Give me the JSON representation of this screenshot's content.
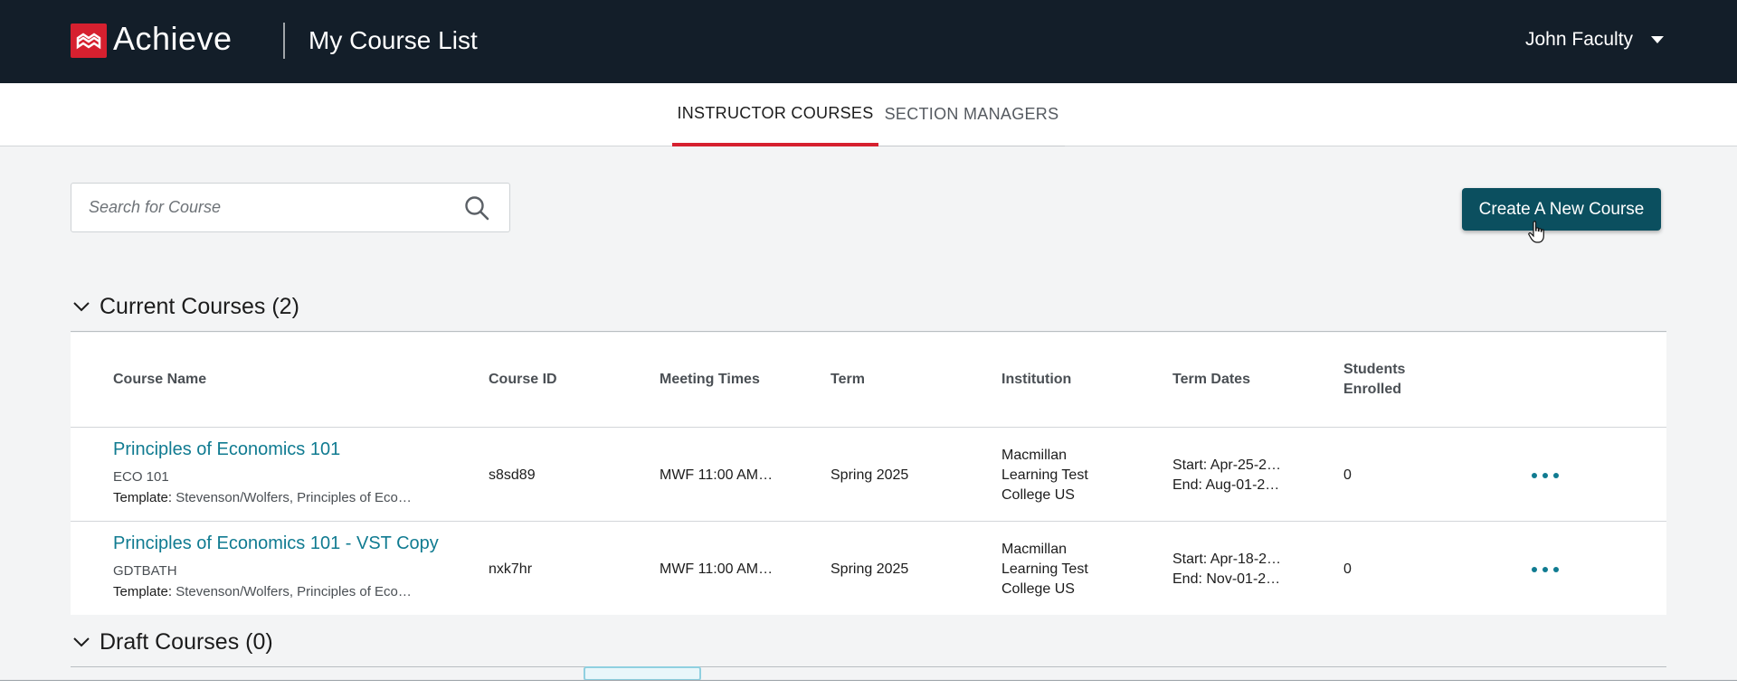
{
  "header": {
    "logo_text": "Achieve",
    "title": "My Course List",
    "user_name": "John Faculty"
  },
  "tabs": [
    {
      "label": "INSTRUCTOR COURSES",
      "active": true
    },
    {
      "label": "SECTION MANAGERS",
      "active": false
    }
  ],
  "search": {
    "placeholder": "Search for Course",
    "value": ""
  },
  "create_button": {
    "label": "Create A New Course"
  },
  "current_courses": {
    "title": "Current Courses (2)",
    "columns": [
      "Course Name",
      "Course ID",
      "Meeting Times",
      "Term",
      "Institution",
      "Term Dates",
      "Students Enrolled"
    ],
    "column_lines": {
      "students_line1": "Students",
      "students_line2": "Enrolled"
    },
    "rows": [
      {
        "name": "Principles of Economics 101",
        "code": "ECO 101",
        "template_label": "Template:",
        "template_value": "Stevenson/Wolfers, Principles of Eco…",
        "course_id": "s8sd89",
        "meeting_times": "MWF 11:00 AM…",
        "term": "Spring 2025",
        "institution_l1": "Macmillan",
        "institution_l2": "Learning Test",
        "institution_l3": "College US",
        "start": "Start: Apr-25-2…",
        "end": "End: Aug-01-2…",
        "enrolled": "0"
      },
      {
        "name": "Principles of Economics 101 - VST Copy",
        "code": "GDTBATH",
        "template_label": "Template:",
        "template_value": "Stevenson/Wolfers, Principles of Eco…",
        "course_id": "nxk7hr",
        "meeting_times": "MWF 11:00 AM…",
        "term": "Spring 2025",
        "institution_l1": "Macmillan",
        "institution_l2": "Learning Test",
        "institution_l3": "College US",
        "start": "Start: Apr-18-2…",
        "end": "End: Nov-01-2…",
        "enrolled": "0"
      }
    ]
  },
  "draft_courses": {
    "title": "Draft Courses (0)"
  },
  "colors": {
    "header_bg": "#131e29",
    "accent_red": "#d6202f",
    "teal_button": "#0b4f5f",
    "link": "#107b91"
  }
}
